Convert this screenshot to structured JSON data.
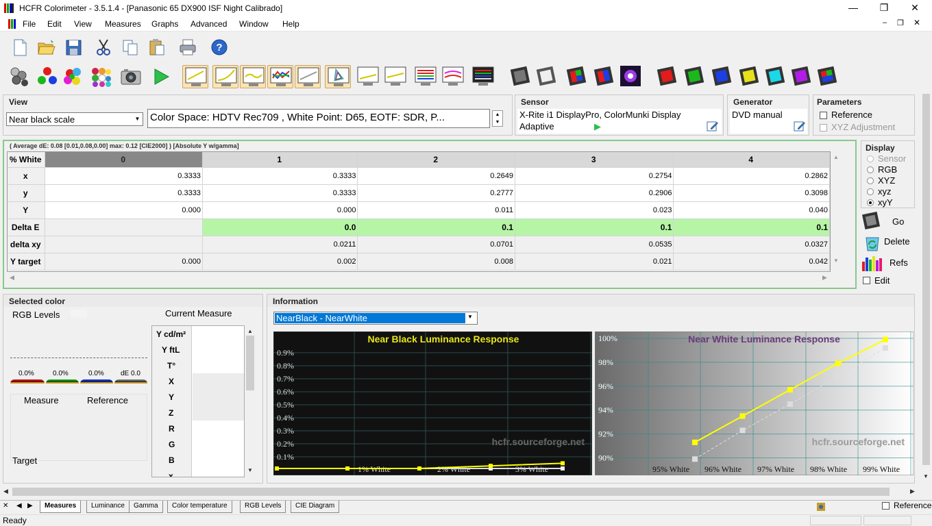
{
  "window": {
    "title": "HCFR Colorimeter - 3.5.1.4 - [Panasonic 65 DX900 ISF Night Calibrado]"
  },
  "menu": [
    "File",
    "Edit",
    "View",
    "Measures",
    "Graphs",
    "Advanced",
    "Window",
    "Help"
  ],
  "view": {
    "label": "View",
    "select_value": "Near black scale",
    "color_space": "Color Space: HDTV Rec709 , White Point: D65, EOTF:  SDR, P..."
  },
  "sensor": {
    "label": "Sensor",
    "name": "X-Rite i1 DisplayPro, ColorMunki Display",
    "mode": "Adaptive"
  },
  "generator": {
    "label": "Generator",
    "name": "DVD manual"
  },
  "parameters": {
    "label": "Parameters",
    "reference": "Reference",
    "xyz_adjustment": "XYZ Adjustment"
  },
  "grid": {
    "summary": "( Average dE: 0.08 [0.01,0.08,0.00] max: 0.12 [CIE2000] ) [Absolute Y w/gamma]",
    "corner": "% White",
    "columns": [
      "0",
      "1",
      "2",
      "3",
      "4"
    ],
    "rows": [
      {
        "label": "x",
        "values": [
          "0.3333",
          "0.3333",
          "0.2649",
          "0.2754",
          "0.2862"
        ]
      },
      {
        "label": "y",
        "values": [
          "0.3333",
          "0.3333",
          "0.2777",
          "0.2906",
          "0.3098"
        ]
      },
      {
        "label": "Y",
        "values": [
          "0.000",
          "0.000",
          "0.011",
          "0.023",
          "0.040"
        ]
      },
      {
        "label": "Delta E",
        "values": [
          "",
          "0.0",
          "0.1",
          "0.1",
          "0.1"
        ]
      },
      {
        "label": "delta xy",
        "values": [
          "",
          "0.0211",
          "0.0701",
          "0.0535",
          "0.0327"
        ]
      },
      {
        "label": "Y target",
        "values": [
          "0.000",
          "0.002",
          "0.008",
          "0.021",
          "0.042"
        ]
      }
    ]
  },
  "display": {
    "label": "Display",
    "options": [
      "Sensor",
      "RGB",
      "XYZ",
      "xyz",
      "xyY"
    ],
    "selected": "xyY"
  },
  "actions": {
    "go": "Go",
    "delete": "Delete",
    "refs": "Refs",
    "edit": "Edit"
  },
  "selected_color": {
    "label": "Selected color",
    "rgb_levels": "RGB Levels",
    "current_measure": "Current Measure",
    "pcts": [
      "0.0%",
      "0.0%",
      "0.0%",
      "dE 0.0"
    ],
    "measure": "Measure",
    "reference": "Reference",
    "target": "Target",
    "rows": [
      "Y cd/m²",
      "Y ftL",
      "T°",
      "X",
      "Y",
      "Z",
      "R",
      "G",
      "B",
      "x"
    ]
  },
  "information": {
    "label": "Information",
    "select_value": "NearBlack - NearWhite"
  },
  "chart_data": [
    {
      "type": "line",
      "title": "Near Black Luminance Response",
      "watermark": "hcfr.sourceforge.net",
      "ytick_labels": [
        "0.1%",
        "0.2%",
        "0.3%",
        "0.4%",
        "0.5%",
        "0.6%",
        "0.7%",
        "0.8%",
        "0.9%"
      ],
      "xtick_labels": [
        "1% White",
        "2% White",
        "3% White"
      ],
      "ylim": [
        0,
        0.01
      ],
      "series": [
        {
          "x": [
            0,
            1,
            2,
            3,
            4
          ],
          "values": [
            0.0,
            0.0,
            0.0,
            0.0002,
            0.0004
          ],
          "color": "#ffff00"
        },
        {
          "x": [
            0,
            1,
            2,
            3,
            4
          ],
          "values": [
            0.0,
            0.0,
            0.0,
            0.0,
            0.0
          ],
          "color": "#dddddd"
        }
      ]
    },
    {
      "type": "line",
      "title": "Near White Luminance Response",
      "watermark": "hcfr.sourceforge.net",
      "ytick_labels": [
        "90%",
        "92%",
        "94%",
        "96%",
        "98%",
        "100%"
      ],
      "xtick_labels": [
        "95% White",
        "96% White",
        "97% White",
        "98% White",
        "99% White"
      ],
      "ylim": [
        89,
        100
      ],
      "series": [
        {
          "x": [
            96,
            97,
            98,
            99,
            100
          ],
          "values": [
            91.3,
            93.5,
            95.7,
            97.9,
            99.9
          ],
          "color": "#ffff00"
        },
        {
          "x": [
            96,
            97,
            98,
            99,
            100
          ],
          "values": [
            89.9,
            92.3,
            94.5,
            96.8,
            99.2
          ],
          "color": "#dddddd"
        }
      ]
    }
  ],
  "tabs": [
    "Measures",
    "Luminance",
    "Gamma",
    "Color temperature",
    "RGB Levels",
    "CIE Diagram"
  ],
  "status": {
    "text": "Ready",
    "reference": "Reference"
  },
  "colors": {
    "accent_green": "#b6f5a6",
    "chart_yellow": "#ffff00",
    "select_blue": "#0078d7"
  }
}
